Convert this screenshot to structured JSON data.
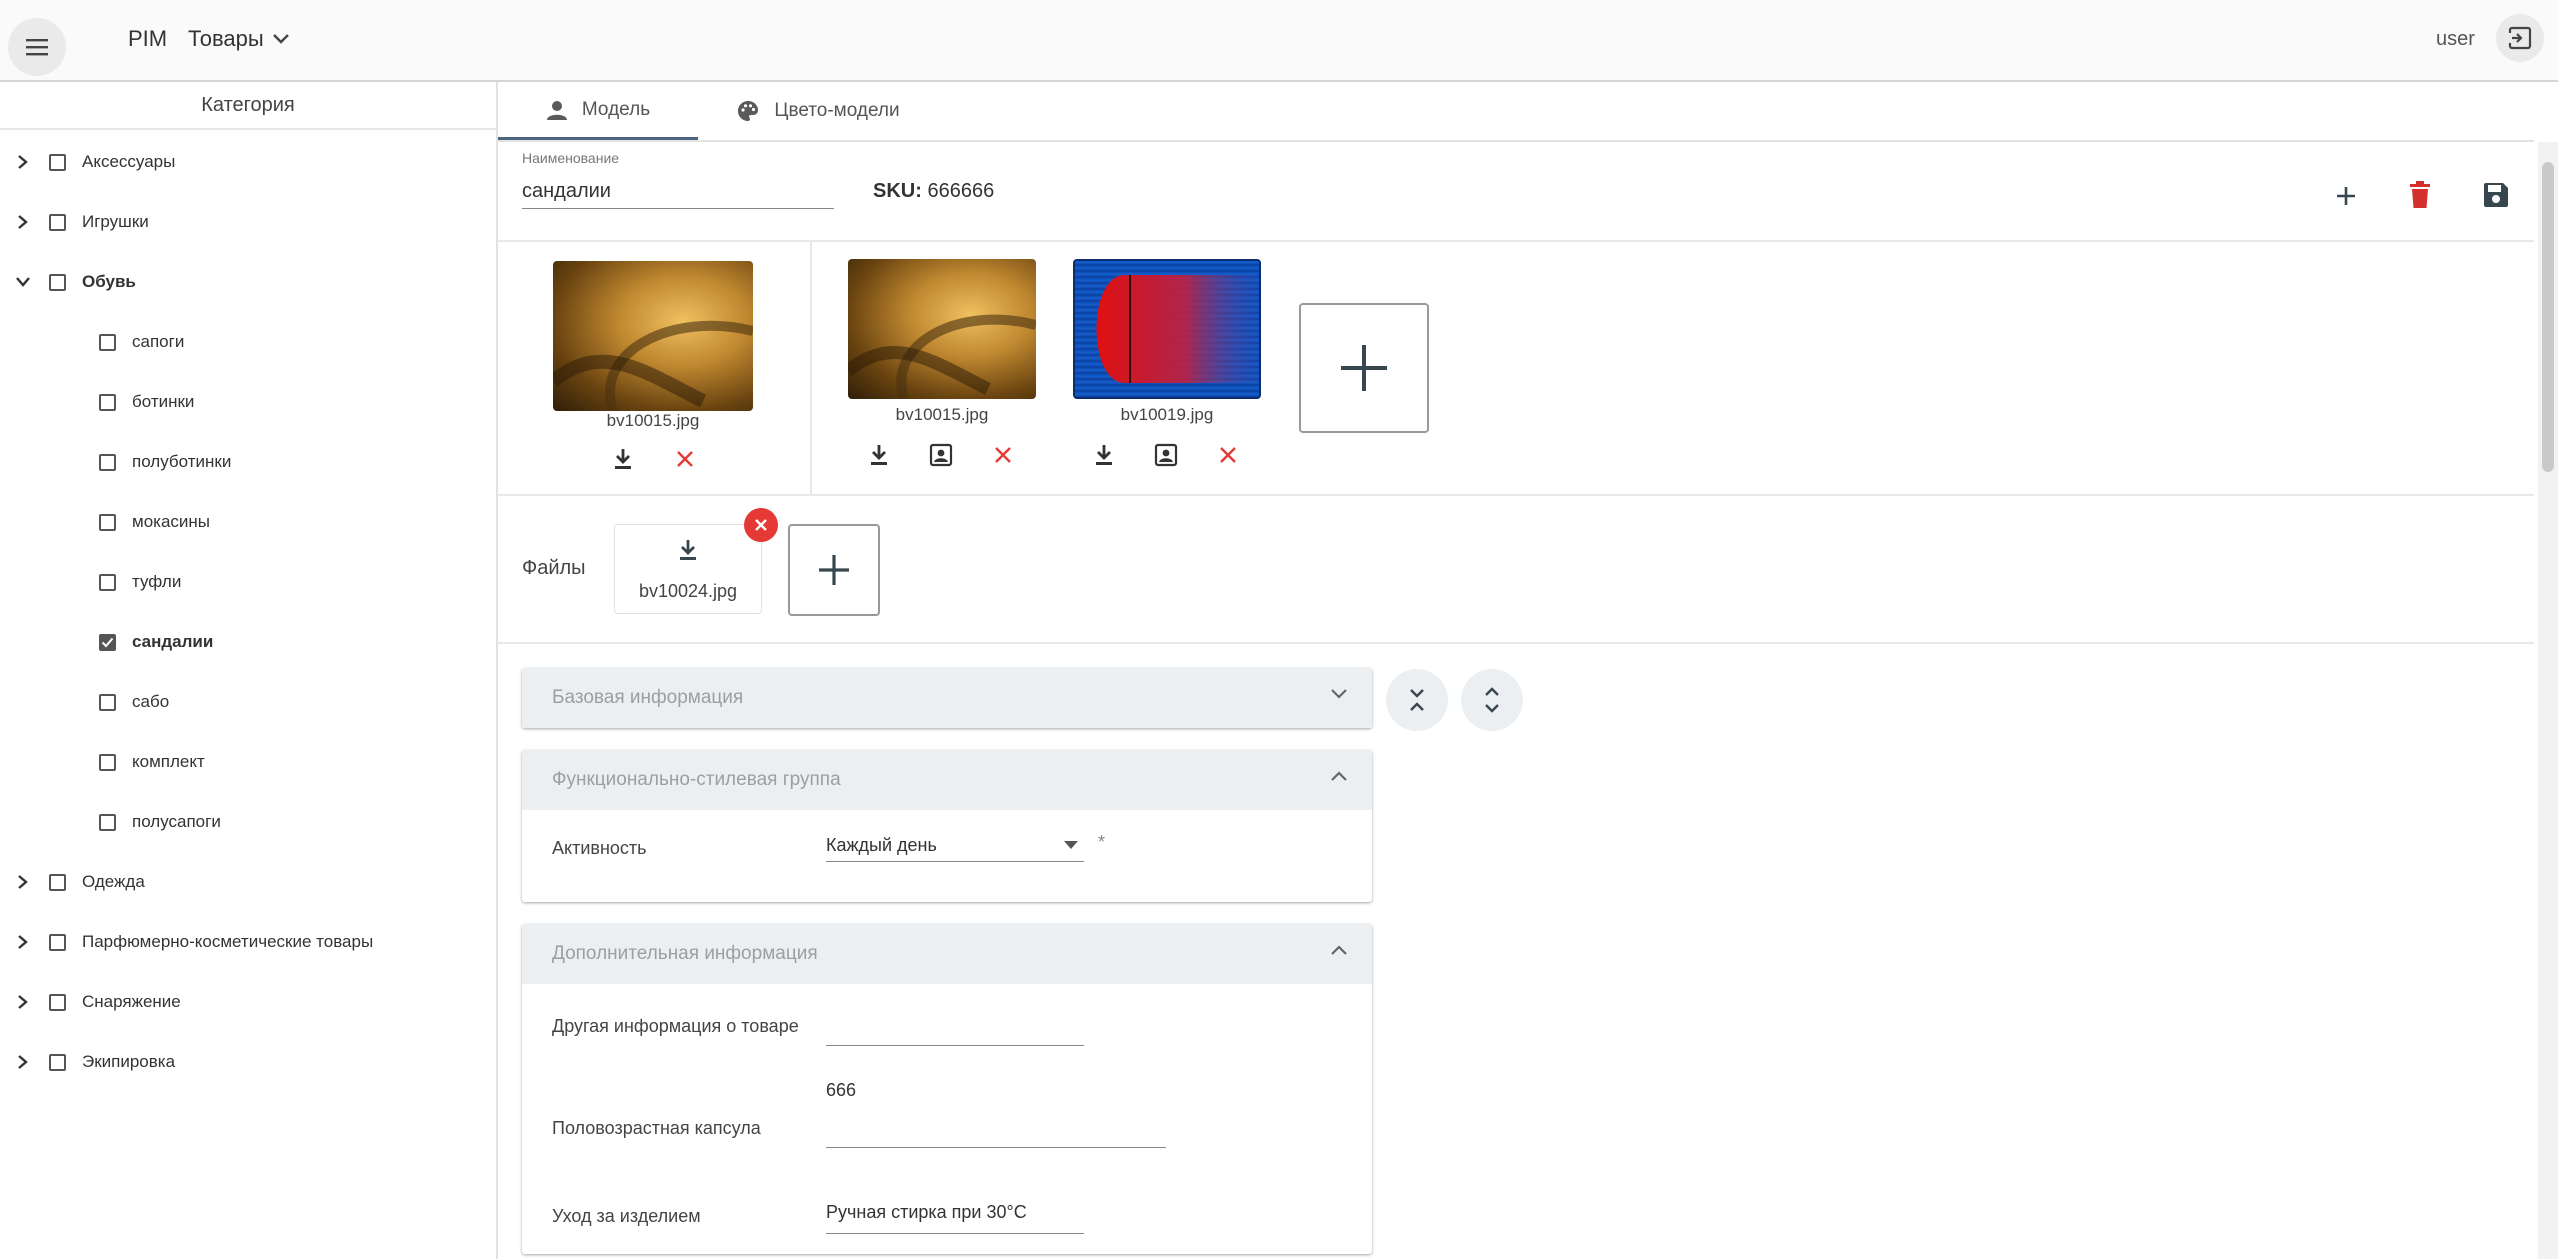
{
  "topbar": {
    "brand": "PIM",
    "section": "Товары",
    "user": "user"
  },
  "sidebar": {
    "title": "Категория",
    "items": [
      {
        "label": "Аксессуары",
        "expandable": true,
        "expanded": false,
        "checked": false,
        "bold": false,
        "level": 0
      },
      {
        "label": "Игрушки",
        "expandable": true,
        "expanded": false,
        "checked": false,
        "bold": false,
        "level": 0
      },
      {
        "label": "Обувь",
        "expandable": true,
        "expanded": true,
        "checked": false,
        "bold": true,
        "level": 0
      },
      {
        "label": "сапоги",
        "expandable": false,
        "checked": false,
        "bold": false,
        "level": 1
      },
      {
        "label": "ботинки",
        "expandable": false,
        "checked": false,
        "bold": false,
        "level": 1
      },
      {
        "label": "полуботинки",
        "expandable": false,
        "checked": false,
        "bold": false,
        "level": 1
      },
      {
        "label": "мокасины",
        "expandable": false,
        "checked": false,
        "bold": false,
        "level": 1
      },
      {
        "label": "туфли",
        "expandable": false,
        "checked": false,
        "bold": false,
        "level": 1
      },
      {
        "label": "сандалии",
        "expandable": false,
        "checked": true,
        "bold": true,
        "level": 1
      },
      {
        "label": "сабо",
        "expandable": false,
        "checked": false,
        "bold": false,
        "level": 1
      },
      {
        "label": "комплект",
        "expandable": false,
        "checked": false,
        "bold": false,
        "level": 1
      },
      {
        "label": "полусапоги",
        "expandable": false,
        "checked": false,
        "bold": false,
        "level": 1
      },
      {
        "label": "Одежда",
        "expandable": true,
        "expanded": false,
        "checked": false,
        "bold": false,
        "level": 0
      },
      {
        "label": "Парфюмерно-косметические товары",
        "expandable": true,
        "expanded": false,
        "checked": false,
        "bold": false,
        "level": 0
      },
      {
        "label": "Снаряжение",
        "expandable": true,
        "expanded": false,
        "checked": false,
        "bold": false,
        "level": 0
      },
      {
        "label": "Экипировка",
        "expandable": true,
        "expanded": false,
        "checked": false,
        "bold": false,
        "level": 0
      }
    ]
  },
  "tabs": [
    {
      "label": "Модель",
      "icon": "person-icon",
      "active": true
    },
    {
      "label": "Цвето-модели",
      "icon": "palette-icon",
      "active": false
    }
  ],
  "header": {
    "name_label": "Наименование",
    "name_value": "сандалии",
    "sku_label": "SKU:",
    "sku_value": "666666"
  },
  "images": {
    "main": {
      "filename": "bv10015.jpg"
    },
    "gallery": [
      {
        "filename": "bv10015.jpg"
      },
      {
        "filename": "bv10019.jpg"
      }
    ]
  },
  "files": {
    "label": "Файлы",
    "items": [
      {
        "filename": "bv10024.jpg"
      }
    ]
  },
  "panels": {
    "basic": {
      "title": "Базовая информация",
      "expanded": false
    },
    "functional": {
      "title": "Функционально-стилевая группа",
      "expanded": true,
      "activity_label": "Активность",
      "activity_value": "Каждый день",
      "required_mark": "*"
    },
    "extra": {
      "title": "Дополнительная информация",
      "expanded": true,
      "fields": [
        {
          "label": "Другая информация о товаре",
          "value": ""
        },
        {
          "label": "Половозрастная капсула",
          "value": "666"
        },
        {
          "label": "Уход за изделием",
          "value": "Ручная стирка при 30°C"
        }
      ]
    }
  },
  "colors": {
    "accent": "#4a6680",
    "danger": "#d32f2f",
    "panel_header": "#eceff1"
  }
}
